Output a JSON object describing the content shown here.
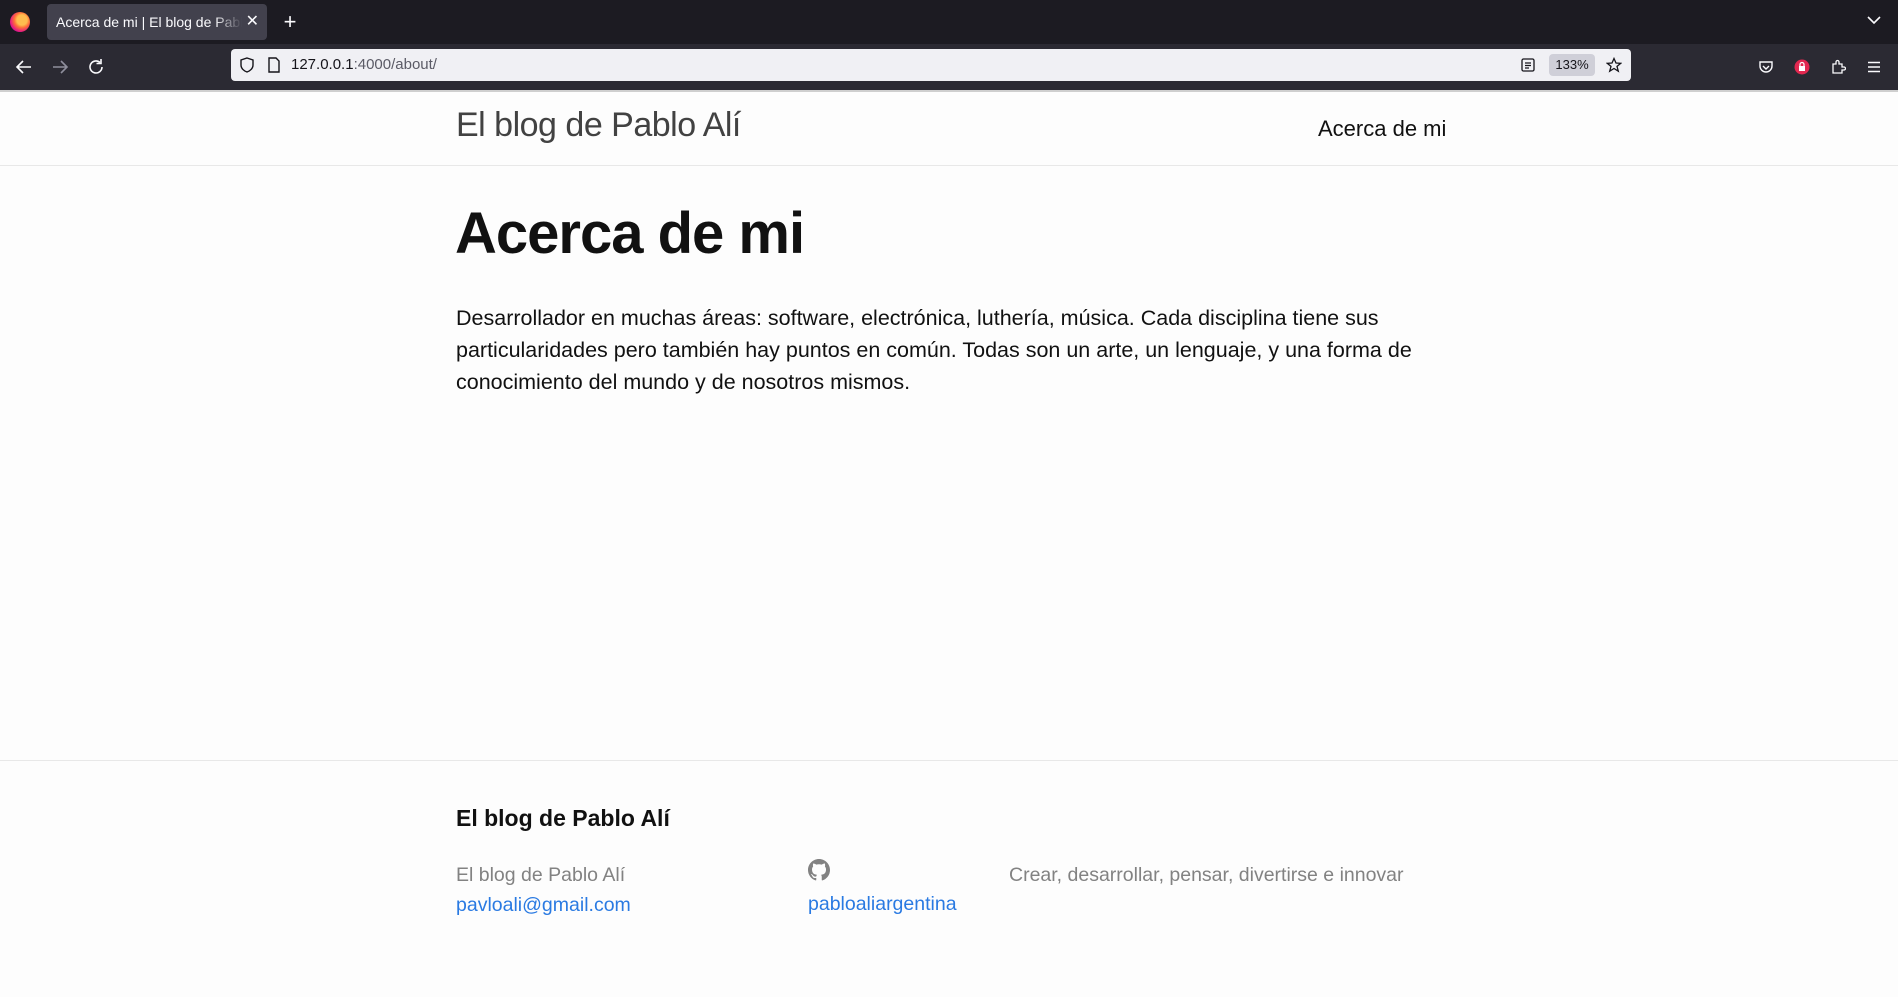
{
  "browser": {
    "tab_title": "Acerca de mi | El blog de Pablo Alí",
    "url_host": "127.0.0.1",
    "url_rest": ":4000/about/",
    "zoom": "133%",
    "icons": [
      "firefox-icon",
      "close-icon",
      "plus-icon",
      "chevron-down-icon",
      "back-icon",
      "forward-icon",
      "reload-icon",
      "shield-icon",
      "page-icon",
      "reader-view-icon",
      "star-icon",
      "pocket-icon",
      "extension-lock-icon",
      "extensions-icon",
      "menu-icon"
    ]
  },
  "header": {
    "site_title": "El blog de Pablo Alí",
    "nav_about": "Acerca de mi"
  },
  "main": {
    "title": "Acerca de mi",
    "body": "Desarrollador en muchas áreas: software, electrónica, luthería, música. Cada disciplina tiene sus particularidades pero también hay puntos en común. Todas son un arte, un lenguaje, y una forma de conocimiento del mundo y de nosotros mismos."
  },
  "footer": {
    "heading": "El blog de Pablo Alí",
    "name": "El blog de Pablo Alí",
    "email": "pavloali@gmail.com",
    "github_user": "pabloaliargentina",
    "tagline": "Crear, desarrollar, pensar, divertirse e innovar"
  }
}
